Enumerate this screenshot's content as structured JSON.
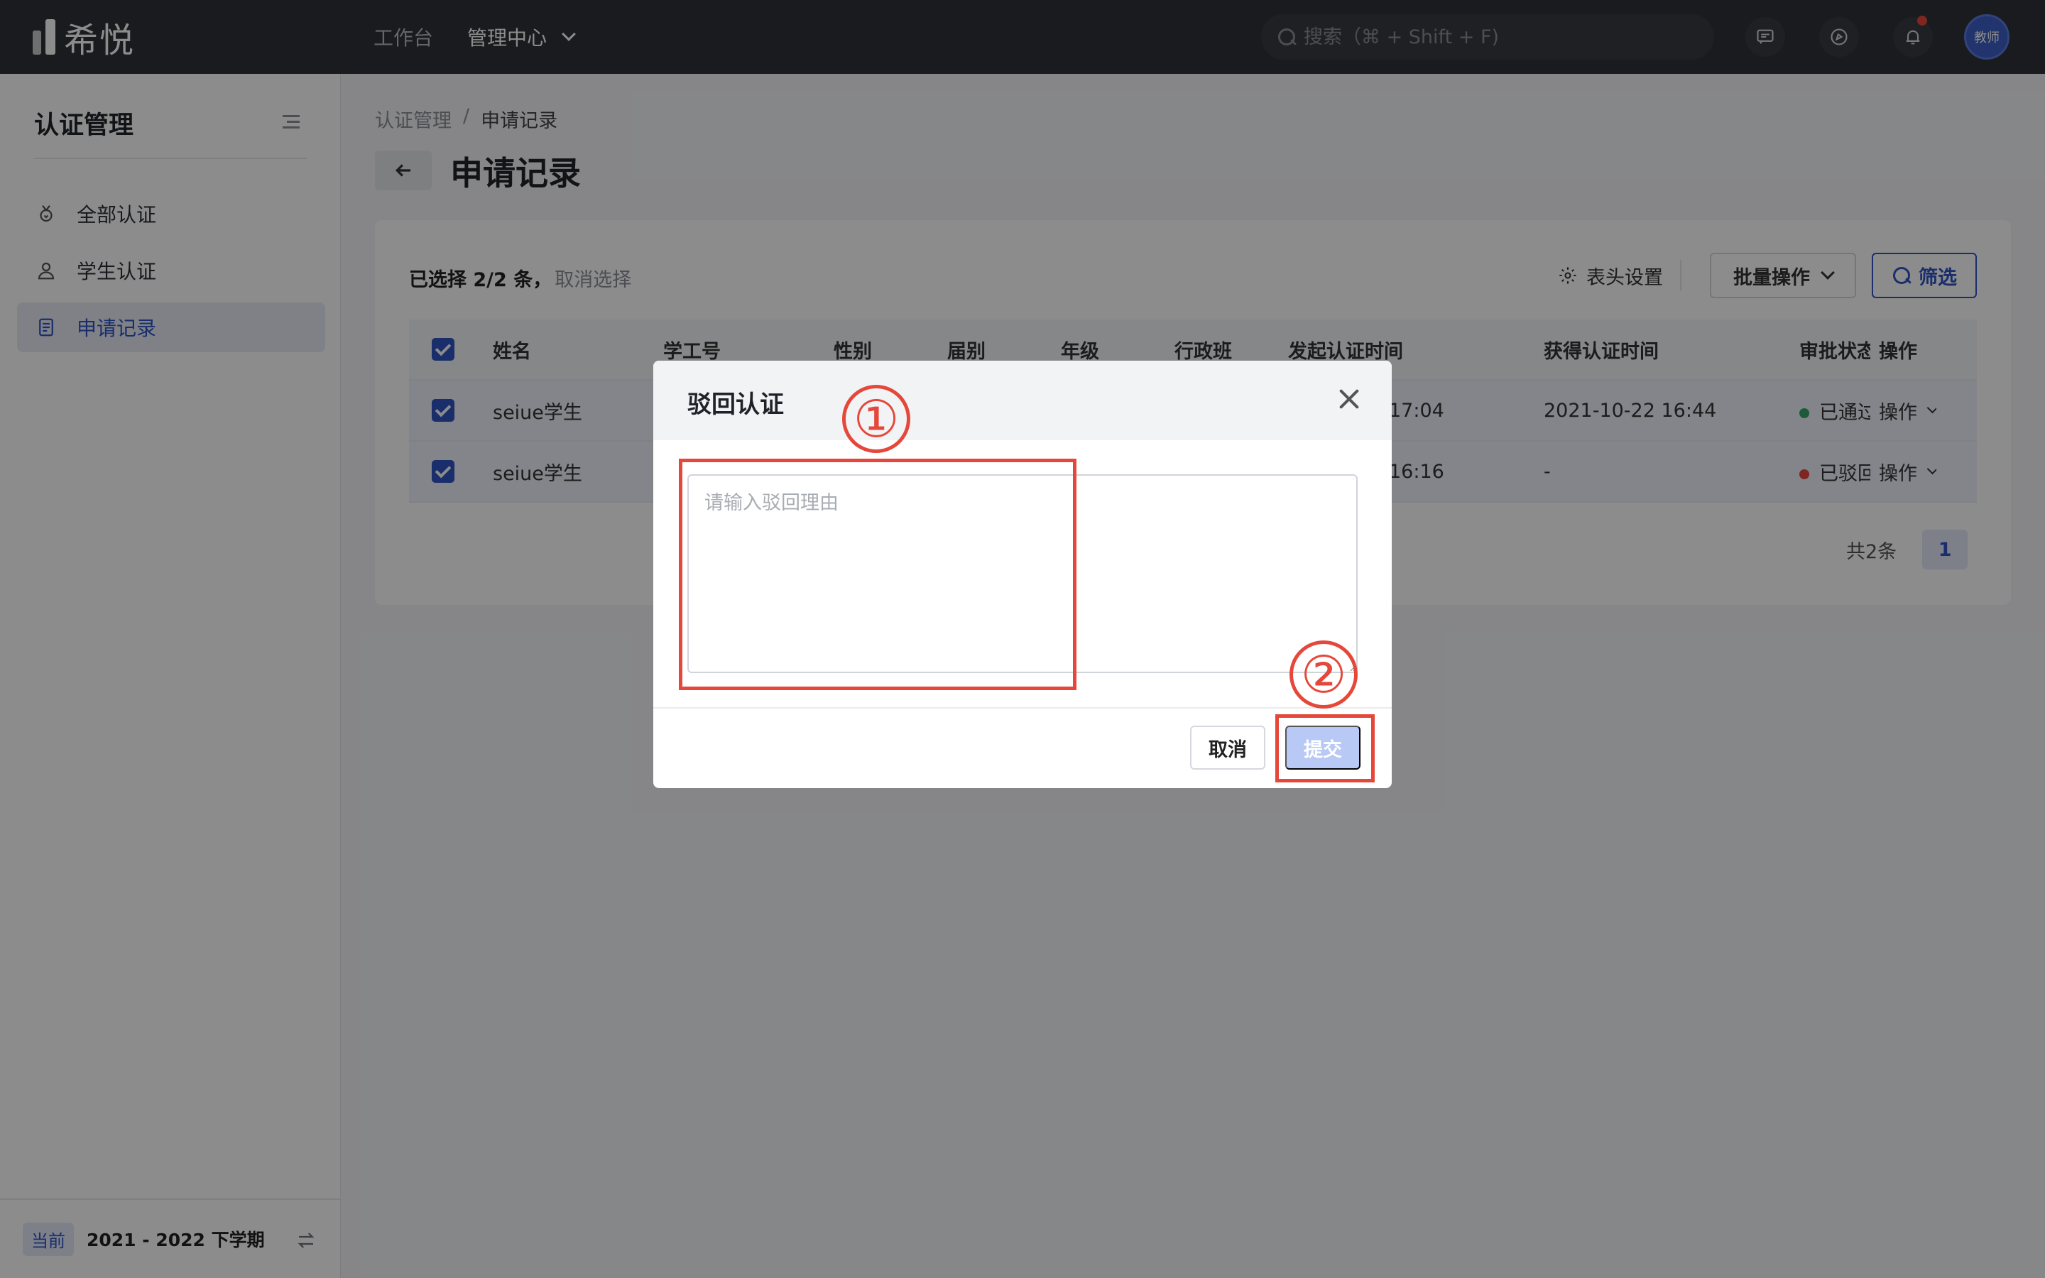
{
  "app": {
    "logo_text": "希悦",
    "nav": [
      {
        "label": "工作台"
      },
      {
        "label": "管理中心"
      }
    ],
    "search_placeholder": "搜索（⌘ + Shift + F)",
    "avatar_label": "教师"
  },
  "sidebar": {
    "title": "认证管理",
    "items": [
      {
        "label": "全部认证",
        "icon": "medal-icon"
      },
      {
        "label": "学生认证",
        "icon": "person-icon"
      },
      {
        "label": "申请记录",
        "icon": "document-icon",
        "active": true
      }
    ],
    "term_tag": "当前",
    "term": "2021 - 2022 下学期"
  },
  "breadcrumb": {
    "parent": "认证管理",
    "separator": "/",
    "current": "申请记录"
  },
  "page": {
    "title": "申请记录"
  },
  "toolbar": {
    "selection": "已选择 2/2 条，",
    "clear_selection": "取消选择",
    "header_settings": "表头设置",
    "batch": "批量操作",
    "filter": "筛选"
  },
  "table": {
    "columns": [
      "姓名",
      "学工号",
      "性别",
      "届别",
      "年级",
      "行政班",
      "发起认证时间",
      "获得认证时间",
      "审批状态",
      "操作"
    ],
    "rows": [
      {
        "name": "seiue学生",
        "start_time": "17:04",
        "granted_time": "2021-10-22 16:44",
        "status": "已通过",
        "status_color": "#35a56b",
        "action": "操作"
      },
      {
        "name": "seiue学生",
        "start_time": "16:16",
        "granted_time": "-",
        "status": "已驳回",
        "status_color": "#e5483b",
        "action": "操作"
      }
    ]
  },
  "pagination": {
    "total": "共2条",
    "current_page": "1"
  },
  "modal": {
    "title": "驳回认证",
    "reason_placeholder": "请输入驳回理由",
    "cancel": "取消",
    "submit": "提交"
  },
  "annotations": {
    "step1": "①",
    "step2": "②",
    "color": "#e5483b"
  }
}
